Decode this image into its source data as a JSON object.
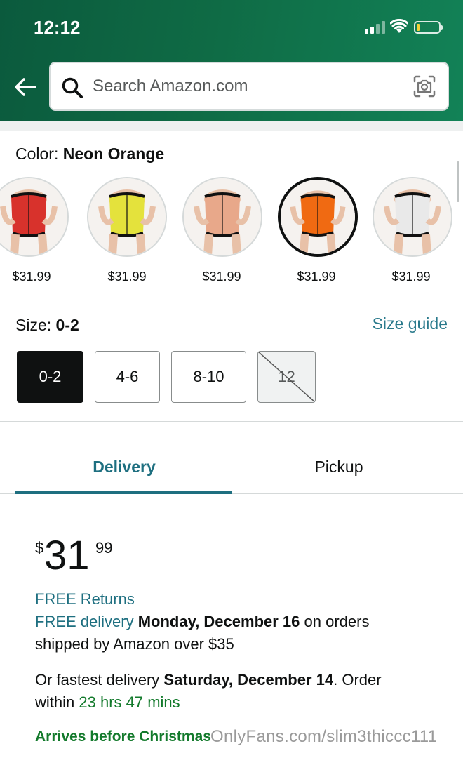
{
  "status_bar": {
    "time": "12:12"
  },
  "search": {
    "placeholder": "Search Amazon.com"
  },
  "color": {
    "label": "Color: ",
    "selected": "Neon Orange",
    "swatches": [
      {
        "price": "$31.99",
        "tone": "#d8322c"
      },
      {
        "price": "$31.99",
        "tone": "#e4e23c"
      },
      {
        "price": "$31.99",
        "tone": "#e8a88a"
      },
      {
        "price": "$31.99",
        "tone": "#f06a12"
      },
      {
        "price": "$31.99",
        "tone": "#e9e9e9"
      }
    ]
  },
  "size": {
    "label": "Size: ",
    "selected": "0-2",
    "guide": "Size guide",
    "options": [
      "0-2",
      "4-6",
      "8-10",
      "12"
    ]
  },
  "tabs": {
    "delivery": "Delivery",
    "pickup": "Pickup"
  },
  "price": {
    "symbol": "$",
    "whole": "31",
    "fraction": "99"
  },
  "delivery": {
    "free_returns": "FREE Returns",
    "free_delivery": "FREE delivery",
    "free_date": "Monday, December 16",
    "free_tail": "on orders",
    "free_line2": "shipped by Amazon over $35",
    "fast_prefix": "Or fastest delivery",
    "fast_date": "Saturday, December 14",
    "fast_tail": ". Order",
    "within": "within",
    "countdown": "23 hrs 47 mins",
    "arrives": "Arrives before Christmas"
  },
  "watermark": "OnlyFans.com/slim3thiccc111",
  "colors": {
    "header_green": "#0f6b45",
    "teal": "#1e6f80",
    "green": "#137a2c"
  }
}
